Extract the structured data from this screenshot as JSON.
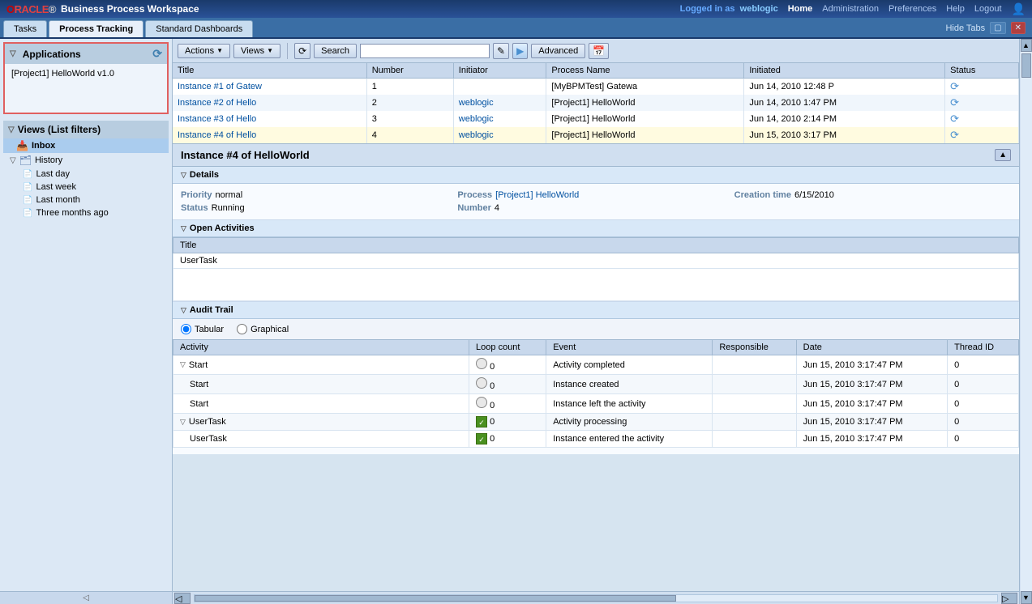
{
  "header": {
    "logo_oracle": "ORACLE",
    "logo_text": "Business Process Workspace",
    "logged_in_label": "Logged in as",
    "username": "weblogic",
    "nav_links": [
      "Home",
      "Administration",
      "Preferences",
      "Help",
      "Logout"
    ]
  },
  "tabs": {
    "items": [
      "Tasks",
      "Process Tracking",
      "Standard Dashboards"
    ],
    "active": "Process Tracking",
    "hide_tabs_label": "Hide Tabs"
  },
  "toolbar": {
    "actions_label": "Actions",
    "views_label": "Views",
    "search_label": "Search",
    "search_placeholder": "",
    "advanced_label": "Advanced"
  },
  "instances_table": {
    "columns": [
      "Title",
      "Number",
      "Initiator",
      "Process Name",
      "Initiated",
      "Status"
    ],
    "rows": [
      {
        "title": "Instance #1 of Gatew",
        "number": "1",
        "initiator": "",
        "process": "[MyBPMTest] Gatewa",
        "initiated": "Jun 14, 2010 12:48 P",
        "status": ""
      },
      {
        "title": "Instance #2 of Hello",
        "number": "2",
        "initiator": "weblogic",
        "process": "[Project1] HelloWorld",
        "initiated": "Jun 14, 2010 1:47 PM",
        "status": ""
      },
      {
        "title": "Instance #3 of Hello",
        "number": "3",
        "initiator": "weblogic",
        "process": "[Project1] HelloWorld",
        "initiated": "Jun 14, 2010 2:14 PM",
        "status": ""
      },
      {
        "title": "Instance #4 of Hello",
        "number": "4",
        "initiator": "weblogic",
        "process": "[Project1] HelloWorld",
        "initiated": "Jun 15, 2010 3:17 PM",
        "status": ""
      }
    ]
  },
  "detail": {
    "title": "Instance #4 of HelloWorld",
    "sections": {
      "details": {
        "label": "Details",
        "priority_label": "Priority",
        "priority_value": "normal",
        "status_label": "Status",
        "status_value": "Running",
        "process_label": "Process",
        "process_value": "[Project1] HelloWorld",
        "number_label": "Number",
        "number_value": "4",
        "creation_label": "Creation time",
        "creation_value": "6/15/2010"
      },
      "open_activities": {
        "label": "Open Activities",
        "columns": [
          "Title"
        ],
        "rows": [
          "UserTask"
        ]
      },
      "audit_trail": {
        "label": "Audit Trail",
        "tabular_label": "Tabular",
        "graphical_label": "Graphical",
        "columns": [
          "Activity",
          "Loop count",
          "Event",
          "Responsible",
          "Date",
          "Thread ID"
        ],
        "rows": [
          {
            "activity": "Start",
            "indent": false,
            "parent": true,
            "loop": "0",
            "event": "Activity completed",
            "responsible": "",
            "date": "Jun 15, 2010 3:17:47 PM",
            "thread": "0"
          },
          {
            "activity": "Start",
            "indent": true,
            "parent": false,
            "loop": "0",
            "event": "Instance created",
            "responsible": "",
            "date": "Jun 15, 2010 3:17:47 PM",
            "thread": "0"
          },
          {
            "activity": "Start",
            "indent": true,
            "parent": false,
            "loop": "0",
            "event": "Instance left the activity",
            "responsible": "",
            "date": "Jun 15, 2010 3:17:47 PM",
            "thread": "0"
          },
          {
            "activity": "UserTask",
            "indent": false,
            "parent": true,
            "loop": "0",
            "event": "Activity processing",
            "responsible": "",
            "date": "Jun 15, 2010 3:17:47 PM",
            "thread": "0"
          },
          {
            "activity": "UserTask",
            "indent": true,
            "parent": false,
            "loop": "0",
            "event": "Instance entered the activity",
            "responsible": "",
            "date": "Jun 15, 2010 3:17:47 PM",
            "thread": "0"
          }
        ]
      }
    }
  },
  "sidebar": {
    "applications_label": "Applications",
    "apps": [
      "[Project1] HelloWorld v1.0"
    ],
    "views_label": "Views (List filters)",
    "inbox_label": "Inbox",
    "history_label": "History",
    "history_children": [
      "Last day",
      "Last week",
      "Last month",
      "Three months ago"
    ]
  }
}
